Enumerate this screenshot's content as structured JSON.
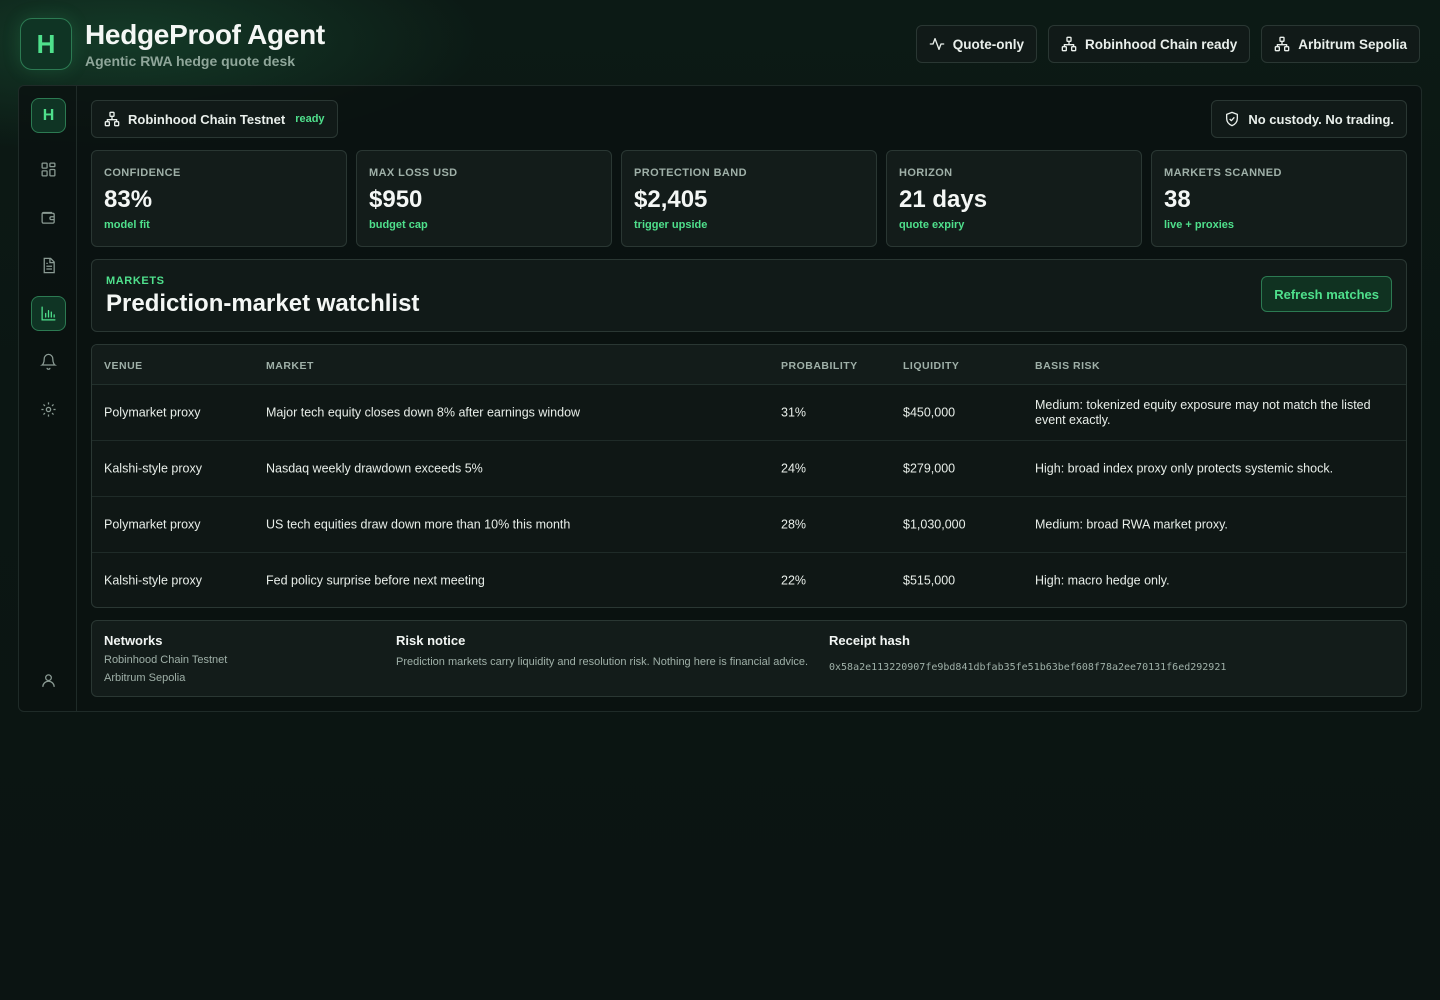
{
  "header": {
    "logo_letter": "H",
    "title": "HedgeProof Agent",
    "subtitle": "Agentic RWA hedge quote desk",
    "pills": [
      {
        "label": "Quote-only",
        "icon": "activity-icon"
      },
      {
        "label": "Robinhood Chain ready",
        "icon": "network-icon"
      },
      {
        "label": "Arbitrum Sepolia",
        "icon": "network-icon"
      }
    ]
  },
  "sidebar": {
    "logo_letter": "H",
    "items": [
      {
        "icon": "dashboard-icon"
      },
      {
        "icon": "wallet-icon"
      },
      {
        "icon": "document-icon"
      },
      {
        "icon": "bar-chart-icon",
        "active": true
      },
      {
        "icon": "bell-icon"
      },
      {
        "icon": "gear-icon"
      },
      {
        "icon": "user-icon"
      }
    ]
  },
  "status": {
    "network": "Robinhood Chain Testnet",
    "network_state": "ready",
    "custody": "No custody. No trading."
  },
  "metrics": [
    {
      "label": "CONFIDENCE",
      "value": "83%",
      "sub": "model fit"
    },
    {
      "label": "MAX LOSS USD",
      "value": "$950",
      "sub": "budget cap"
    },
    {
      "label": "PROTECTION BAND",
      "value": "$2,405",
      "sub": "trigger upside"
    },
    {
      "label": "HORIZON",
      "value": "21 days",
      "sub": "quote expiry"
    },
    {
      "label": "MARKETS SCANNED",
      "value": "38",
      "sub": "live + proxies"
    }
  ],
  "watchlist": {
    "eyebrow": "MARKETS",
    "title": "Prediction-market watchlist",
    "refresh_label": "Refresh matches"
  },
  "table": {
    "headers": [
      "VENUE",
      "MARKET",
      "PROBABILITY",
      "LIQUIDITY",
      "BASIS RISK"
    ],
    "rows": [
      [
        "Polymarket proxy",
        "Major tech equity closes down 8% after earnings window",
        "31%",
        "$450,000",
        "Medium: tokenized equity exposure may not match the listed event exactly."
      ],
      [
        "Kalshi-style proxy",
        "Nasdaq weekly drawdown exceeds 5%",
        "24%",
        "$279,000",
        "High: broad index proxy only protects systemic shock."
      ],
      [
        "Polymarket proxy",
        "US tech equities draw down more than 10% this month",
        "28%",
        "$1,030,000",
        "Medium: broad RWA market proxy."
      ],
      [
        "Kalshi-style proxy",
        "Fed policy surprise before next meeting",
        "22%",
        "$515,000",
        "High: macro hedge only."
      ]
    ]
  },
  "footer": {
    "networks_title": "Networks",
    "networks": [
      "Robinhood Chain Testnet",
      "Arbitrum Sepolia"
    ],
    "risk_title": "Risk notice",
    "risk_text": "Prediction markets carry liquidity and resolution risk. Nothing here is financial advice.",
    "receipt_title": "Receipt hash",
    "receipt_hash": "0x58a2e113220907fe9bd841dbfab35fe51b63bef608f78a2ee70131f6ed292921"
  },
  "colors": {
    "accent": "#4fe08c",
    "background": "#0b1613",
    "panel": "#131c1a",
    "border": "#2a3733"
  }
}
